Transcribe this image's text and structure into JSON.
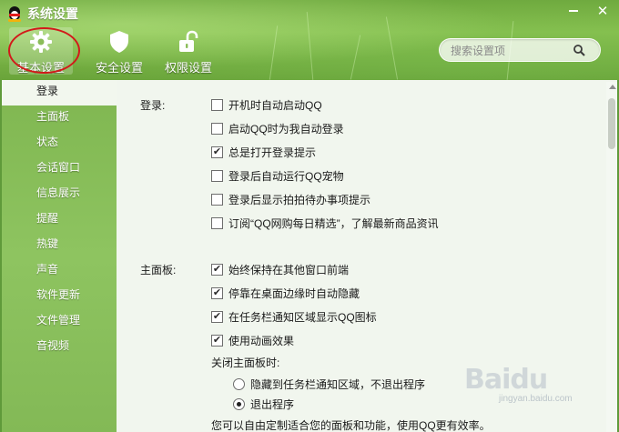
{
  "window": {
    "title": "系统设置",
    "minimize_label": "—",
    "close_label": "✕"
  },
  "tabs": [
    {
      "label": "基本设置",
      "icon": "gear-icon"
    },
    {
      "label": "安全设置",
      "icon": "shield-icon"
    },
    {
      "label": "权限设置",
      "icon": "unlock-icon"
    }
  ],
  "search": {
    "placeholder": "搜索设置项",
    "value": ""
  },
  "sidebar": {
    "items": [
      {
        "label": "登录"
      },
      {
        "label": "主面板"
      },
      {
        "label": "状态"
      },
      {
        "label": "会话窗口"
      },
      {
        "label": "信息展示"
      },
      {
        "label": "提醒"
      },
      {
        "label": "热键"
      },
      {
        "label": "声音"
      },
      {
        "label": "软件更新"
      },
      {
        "label": "文件管理"
      },
      {
        "label": "音视频"
      }
    ]
  },
  "login": {
    "label": "登录:",
    "options": [
      {
        "text": "开机时自动启动QQ",
        "checked": false
      },
      {
        "text": "启动QQ时为我自动登录",
        "checked": false
      },
      {
        "text": "总是打开登录提示",
        "checked": true
      },
      {
        "text": "登录后自动运行QQ宠物",
        "checked": false
      },
      {
        "text": "登录后显示拍拍待办事项提示",
        "checked": false
      },
      {
        "text": "订阅“QQ网购每日精选”，了解最新商品资讯",
        "checked": false
      }
    ]
  },
  "panel": {
    "label": "主面板:",
    "options": [
      {
        "text": "始终保持在其他窗口前端",
        "checked": true
      },
      {
        "text": "停靠在桌面边缘时自动隐藏",
        "checked": true
      },
      {
        "text": "在任务栏通知区域显示QQ图标",
        "checked": true
      },
      {
        "text": "使用动画效果",
        "checked": true
      }
    ],
    "close_label": "关闭主面板时:",
    "close_options": [
      {
        "text": "隐藏到任务栏通知区域，不退出程序",
        "selected": false
      },
      {
        "text": "退出程序",
        "selected": true
      }
    ],
    "footer": "您可以自由定制适合您的面板和功能，使用QQ更有效率。"
  },
  "watermark": {
    "logo": "Baidu",
    "sub": "jingyan.baidu.com"
  },
  "colors": {
    "accent_green": "#6faa3f",
    "annotation_red": "#d21a1a",
    "panel_bg": "#f1f6ee"
  }
}
